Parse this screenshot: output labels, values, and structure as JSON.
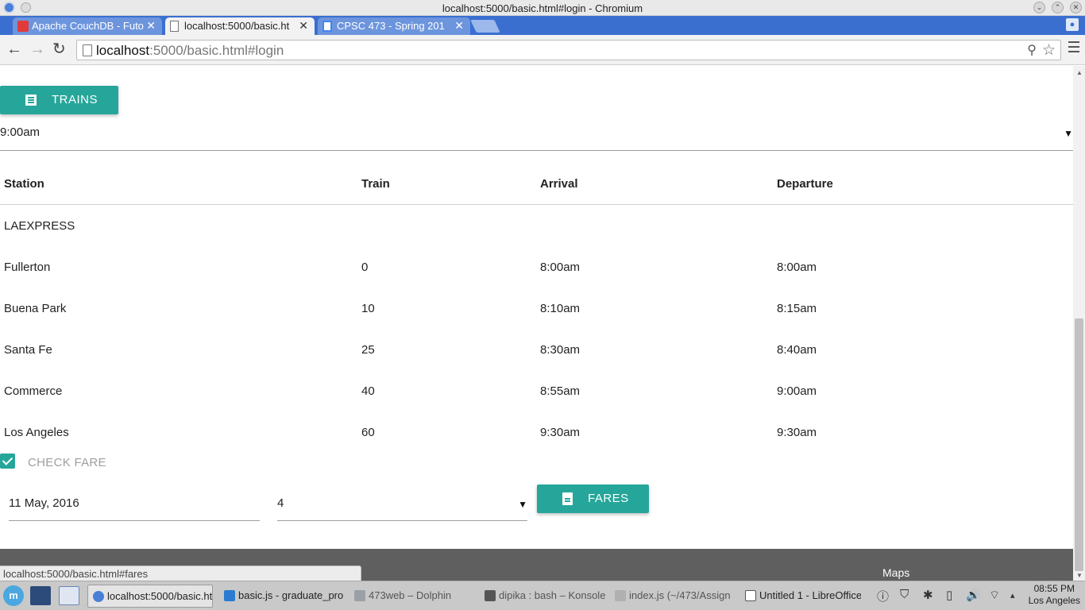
{
  "window": {
    "title": "localhost:5000/basic.html#login - Chromium",
    "minimize_glyph": "⌄",
    "restore_glyph": "⌃",
    "close_glyph": "✕"
  },
  "tabs": [
    {
      "label": "Apache CouchDB - Futo",
      "close": "✕",
      "icon": "couchdb-icon"
    },
    {
      "label": "localhost:5000/basic.ht",
      "close": "✕",
      "icon": "page-icon",
      "active": true
    },
    {
      "label": "CPSC 473 - Spring 201",
      "close": "✕",
      "icon": "docs-icon"
    }
  ],
  "toolbar": {
    "back": "←",
    "forward": "→",
    "reload": "↻",
    "url_host": "localhost",
    "url_rest": ":5000/basic.html#login",
    "key_glyph": "⚲",
    "star_glyph": "☆"
  },
  "page": {
    "trains_button": "TRAINS",
    "time_select": "9:00am",
    "caret": "▼",
    "table": {
      "headers": [
        "Station",
        "Train",
        "Arrival",
        "Departure"
      ],
      "group_label": "LAEXPRESS",
      "rows": [
        [
          "Fullerton",
          "0",
          "8:00am",
          "8:00am"
        ],
        [
          "Buena Park",
          "10",
          "8:10am",
          "8:15am"
        ],
        [
          "Santa Fe",
          "25",
          "8:30am",
          "8:40am"
        ],
        [
          "Commerce",
          "40",
          "8:55am",
          "9:00am"
        ],
        [
          "Los Angeles",
          "60",
          "9:30am",
          "9:30am"
        ]
      ]
    },
    "check_fare_label": "CHECK FARE",
    "date_field": "11 May, 2016",
    "qty_select": "4",
    "fares_button": "FARES",
    "footer_link": "Maps",
    "status_url": "localhost:5000/basic.html#fares"
  },
  "taskbar": {
    "start_glyph": "m",
    "items": [
      {
        "label": "localhost:5000/basic.ht",
        "active": true
      },
      {
        "label": "basic.js - graduate_pro"
      },
      {
        "label": "473web – Dolphin"
      },
      {
        "label": "dipika : bash – Konsole"
      },
      {
        "label": "index.js (~/473/Assign"
      },
      {
        "label": "Untitled 1 - LibreOffice"
      }
    ],
    "tray": [
      "ⓘ",
      "⛉",
      "✱",
      "▯",
      "🔊",
      "⌔",
      "▴"
    ],
    "time": "08:55 PM",
    "location": "Los Angeles"
  }
}
